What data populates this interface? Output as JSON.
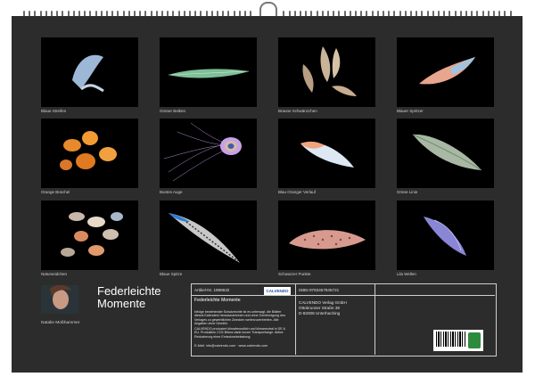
{
  "captions": [
    "Blaue Streifen",
    "Grüner Balken",
    "Braune Schwänzchen",
    "Blauer Spritzer",
    "Orange Büschel",
    "Buntes Auge",
    "Blau Oranger Verlauf",
    "Grüne Linie",
    "Naturseidchen",
    "Blaue Spitze",
    "Schwarzer Punkte",
    "Lila Wellen"
  ],
  "title": {
    "line1": "Federleichte",
    "line2": "Momente"
  },
  "author": "Natalie Moßhammer",
  "info": {
    "article": "Artikel-Nr. 1998632",
    "isbn": "ISBN 9783457845721",
    "product_title": "Federleichte Momente",
    "publisher_logo": "CALVENDO",
    "publisher_1": "CALVENDO Verlag GmbH",
    "publisher_2": "Ottobrunner Straße 39",
    "publisher_3": "D-82008 Unterhaching",
    "notice_1": "Infolge bestehender Schutzrechte ist es untersagt, die Blätter dieses Kalenders herauszutrennen und ohne Genehmigung des Verlages zu gewerblichen Zwecken weiterzuverbreiten. Alle Angaben ohne Gewähr.",
    "notice_2": "CALVENDO produziert klimafreundlich und klimaneutral in DE & EU. Produktion CO2-Bilanz dank kurzer Transportwege. Aktive Reduzierung einer Emissionsbelastung.",
    "contact": "E-Mail: info@calvendo.com · www.calvendo.com"
  }
}
